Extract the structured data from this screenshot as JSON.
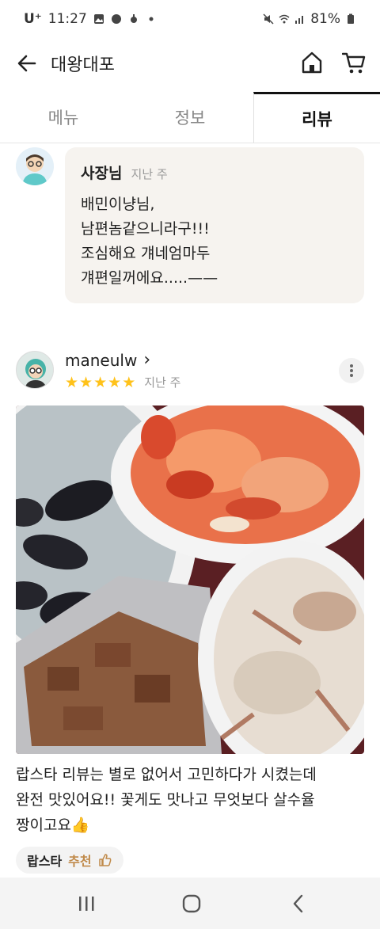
{
  "status_bar": {
    "carrier": "U⁺",
    "time": "11:27",
    "battery": "81%"
  },
  "header": {
    "title": "대왕대포"
  },
  "tabs": [
    {
      "label": "메뉴",
      "active": false
    },
    {
      "label": "정보",
      "active": false
    },
    {
      "label": "리뷰",
      "active": true
    }
  ],
  "owner_reply": {
    "name": "사장님",
    "time": "지난 주",
    "lines": [
      "배민이냥님,",
      "남편놈같으니라구!!!",
      "조심해요  걔네엄마두",
      "걔편일꺼에요.....——"
    ]
  },
  "review": {
    "username": "maneulw",
    "username_chevron": "›",
    "rating": 5,
    "stars": [
      "★",
      "★",
      "★",
      "★",
      "★"
    ],
    "time": "지난 주",
    "text_lines": [
      "랍스타 리뷰는 별로 없어서 고민하다가 시켰는데",
      "완전 맛있어요!! 꽃게도 맛나고 무엇보다 살수율",
      "짱이고요"
    ],
    "text_emoji": "👍",
    "recommend_chip": {
      "item": "랍스타",
      "label": "추천"
    }
  },
  "colors": {
    "star": "#ffc21a",
    "bubble_bg": "#f6f3ef",
    "recommend": "#c08a4a"
  }
}
